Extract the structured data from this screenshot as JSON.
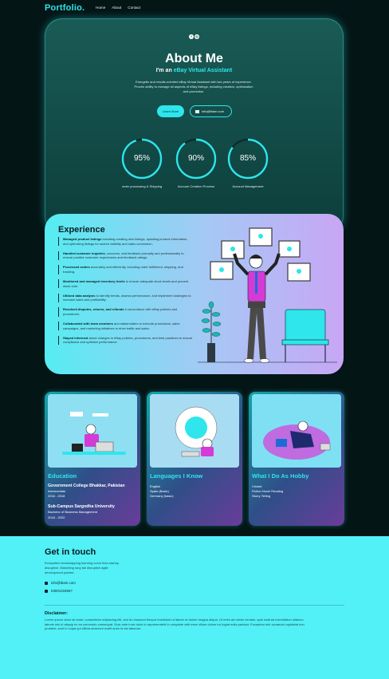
{
  "nav": {
    "logo": "Portfolio.",
    "links": [
      "Home",
      "About",
      "Contact"
    ]
  },
  "hero": {
    "social_icons": [
      "facebook-icon",
      "instagram-icon"
    ],
    "title": "About Me",
    "subtitle_prefix": "I'm an ",
    "subtitle_accent": "eBay Virtual Assistant",
    "description": "Energetic and results-oriented eBay Virtual Assistant with two years of experience. Proven ability to manage all aspects of eBay listings, including creation, optimization and promotion.",
    "learn_button": "Learn More",
    "email_button": "info@tbam.com",
    "gauges": [
      {
        "value": 95,
        "label": "95%",
        "caption": "order processing & Shipping"
      },
      {
        "value": 90,
        "label": "90%",
        "caption": "Account Creation Process"
      },
      {
        "value": 85,
        "label": "85%",
        "caption": "Account Management"
      }
    ]
  },
  "experience": {
    "title": "Experience",
    "items": [
      {
        "bold": "Managed product listings",
        "text": " including creating new listings, updating product information, and optimizing listings for search visibility and sales conversion."
      },
      {
        "bold": "Handled customer inquiries",
        "text": ", concerns, and feedback promptly and professionally to ensure positive customer experiences and feedback ratings."
      },
      {
        "bold": "Processed orders",
        "text": " accurately and efficiently, including order fulfillment, shipping, and tracking."
      },
      {
        "bold": "Monitored and managed inventory levels",
        "text": " to ensure adequate stock levels and prevent stock outs."
      },
      {
        "bold": "Utilized data analysis",
        "text": " to identify trends, assess performance, and implement strategies to increase sales and profitability."
      },
      {
        "bold": "Resolved disputes, returns, and refunds",
        "text": " in accordance with eBay policies and procedures."
      },
      {
        "bold": "Collaborated with team members",
        "text": " and stakeholders to execute promotions, sales campaigns, and marketing initiatives to drive traffic and sales."
      },
      {
        "bold": "Stayed informed",
        "text": " about changes in eBay policies, procedures, and best practices to ensure compliance and optimize performance."
      }
    ]
  },
  "cards": [
    {
      "title": "Education",
      "lines": [
        {
          "text": "Government College Bhakkar, Pakistan",
          "bold": true
        },
        {
          "text": "Intermediate",
          "bold": false
        },
        {
          "text": "2016 - 2018",
          "bold": false
        },
        {
          "text": "Sub-Campus Sargodha University",
          "bold": true
        },
        {
          "text": "Bachelor of Business Management",
          "bold": false
        },
        {
          "text": "2018 - 2022",
          "bold": false
        }
      ]
    },
    {
      "title": "Languages I Know",
      "lines": [
        {
          "text": "English",
          "bold": false
        },
        {
          "text": "Spain (Basic)",
          "bold": false
        },
        {
          "text": "Germany (basic)",
          "bold": false
        }
      ]
    },
    {
      "title": "What I Do As Hobby",
      "lines": [
        {
          "text": "Cricket",
          "bold": false
        },
        {
          "text": "Fiction Novel Reading",
          "bold": false
        },
        {
          "text": "Storry Telling",
          "bold": false
        }
      ]
    }
  ],
  "contact": {
    "title": "Get in touch",
    "description": "Ecosystem bootstrapping learning curve lean startup disruptive. Marketing long tail disruptive agile development partner.",
    "email": "info@tbam.com",
    "phone": "0300123456?",
    "disclaimer_title": "Disclaimer:",
    "disclaimer_text": "Lorem ipsum dolor sit amet, consectetur adipiscing elit, sed do eiusmod tempor incididunt ut labore et dolore magna aliqua. Ut enim ad minim veniam, quis nostrud exercitation ullamco laboris nisi ut aliquip ex ea commodo consequat. Duis aute irure dolor in reprehenderit in voluptate velit esse cillum dolore eu fugiat nulla pariatur. Excepteur sint occaecat cupidatat non proident, sunt in culpa qui officia deserunt mollit anim id est laborum."
  },
  "colors": {
    "accent": "#2ee6ec",
    "background": "#041516",
    "contact_bg": "#52f0f7",
    "shirt": "#d43bd6"
  }
}
